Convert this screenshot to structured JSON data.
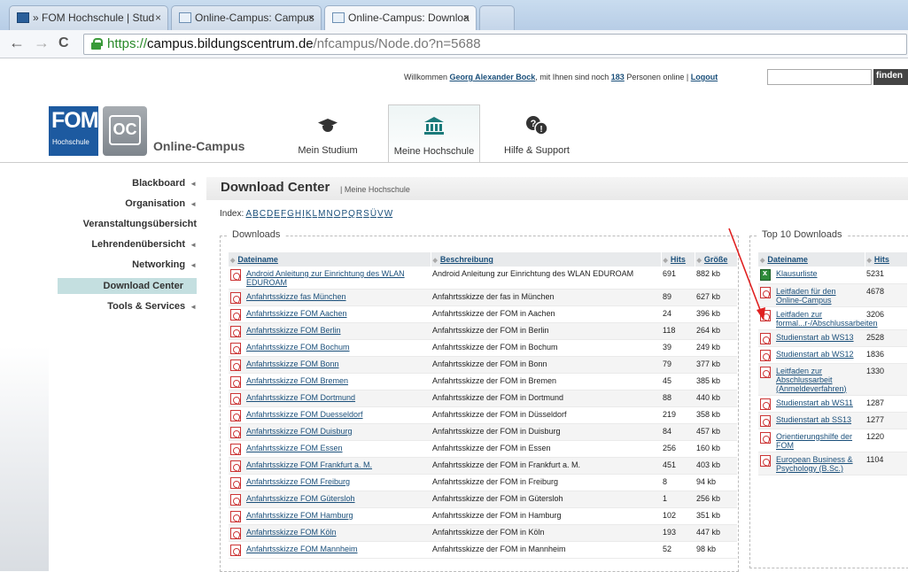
{
  "browser": {
    "tabs": [
      {
        "label": "» FOM Hochschule | Stud",
        "close": "×"
      },
      {
        "label": "Online-Campus: Campus",
        "close": "×"
      },
      {
        "label": "Online-Campus: Downloa",
        "close": "×"
      }
    ],
    "url": {
      "scheme": "https://",
      "host": "campus.bildungscentrum.de",
      "path": "/nfcampus/Node.do?n=5688"
    },
    "nav": {
      "back": "←",
      "forward": "→",
      "reload": "C"
    }
  },
  "header": {
    "welcome_prefix": "Willkommen ",
    "user_name": "Georg Alexander Bock",
    "welcome_middle": ", mit Ihnen sind noch ",
    "online_count": "183",
    "welcome_suffix": " Personen online | ",
    "logout": "Logout",
    "search_placeholder": "",
    "search_button": "finden",
    "logo_fom": "FOM",
    "logo_fom_sub": "Hochschule",
    "logo_oc": "OC",
    "logo_text": "Online-Campus",
    "nav": [
      {
        "label": "Mein Studium",
        "icon": "mortarboard-icon"
      },
      {
        "label": "Meine Hochschule",
        "icon": "building-columns-icon"
      },
      {
        "label": "Hilfe & Support",
        "icon": "help-bubbles-icon"
      }
    ]
  },
  "sidebar": {
    "items": [
      {
        "label": "Blackboard",
        "arrow": "◄"
      },
      {
        "label": "Organisation",
        "arrow": "◄"
      },
      {
        "label": "Veranstaltungsübersicht",
        "arrow": ""
      },
      {
        "label": "Lehrendenübersicht",
        "arrow": "◄"
      },
      {
        "label": "Networking",
        "arrow": "◄"
      },
      {
        "label": "Download Center",
        "arrow": ""
      },
      {
        "label": "Tools & Services",
        "arrow": "◄"
      }
    ],
    "active": "Download Center"
  },
  "main": {
    "title": "Download Center",
    "crumb": "| Meine Hochschule",
    "index_label": "Index: ",
    "index_letters": [
      "A",
      "B",
      "C",
      "D",
      "E",
      "F",
      "G",
      "H",
      "I",
      "K",
      "L",
      "M",
      "N",
      "O",
      "P",
      "Q",
      "R",
      "S",
      "Ü",
      "V",
      "W"
    ],
    "downloads": {
      "legend": "Downloads",
      "columns": [
        "Dateiname",
        "Beschreibung",
        "Hits",
        "Größe"
      ],
      "rows": [
        [
          "Android Anleitung zur Einrichtung des WLAN EDUROAM",
          "Android Anleitung zur Einrichtung des WLAN EDUROAM",
          "691",
          "882 kb"
        ],
        [
          "Anfahrtsskizze fas München",
          "Anfahrtsskizze der fas in München",
          "89",
          "627 kb"
        ],
        [
          "Anfahrtsskizze FOM Aachen",
          "Anfahrtsskizze der FOM in Aachen",
          "24",
          "396 kb"
        ],
        [
          "Anfahrtsskizze FOM Berlin",
          "Anfahrtsskizze der FOM in Berlin",
          "118",
          "264 kb"
        ],
        [
          "Anfahrtsskizze FOM Bochum",
          "Anfahrtsskizze der FOM in Bochum",
          "39",
          "249 kb"
        ],
        [
          "Anfahrtsskizze FOM Bonn",
          "Anfahrtsskizze der FOM in Bonn",
          "79",
          "377 kb"
        ],
        [
          "Anfahrtsskizze FOM Bremen",
          "Anfahrtsskizze der FOM in Bremen",
          "45",
          "385 kb"
        ],
        [
          "Anfahrtsskizze FOM Dortmund",
          "Anfahrtsskizze der FOM in Dortmund",
          "88",
          "440 kb"
        ],
        [
          "Anfahrtsskizze FOM Duesseldorf",
          "Anfahrtsskizze der FOM in Düsseldorf",
          "219",
          "358 kb"
        ],
        [
          "Anfahrtsskizze FOM Duisburg",
          "Anfahrtsskizze der FOM in Duisburg",
          "84",
          "457 kb"
        ],
        [
          "Anfahrtsskizze FOM Essen",
          "Anfahrtsskizze der FOM in Essen",
          "256",
          "160 kb"
        ],
        [
          "Anfahrtsskizze FOM Frankfurt a. M.",
          "Anfahrtsskizze der FOM in Frankfurt a. M.",
          "451",
          "403 kb"
        ],
        [
          "Anfahrtsskizze FOM Freiburg",
          "Anfahrtsskizze der FOM in Freiburg",
          "8",
          "94 kb"
        ],
        [
          "Anfahrtsskizze FOM Gütersloh",
          "Anfahrtsskizze der FOM in Gütersloh",
          "1",
          "256 kb"
        ],
        [
          "Anfahrtsskizze FOM Hamburg",
          "Anfahrtsskizze der FOM in Hamburg",
          "102",
          "351 kb"
        ],
        [
          "Anfahrtsskizze FOM Köln",
          "Anfahrtsskizze der FOM in Köln",
          "193",
          "447 kb"
        ],
        [
          "Anfahrtsskizze FOM Mannheim",
          "Anfahrtsskizze der FOM in Mannheim",
          "52",
          "98 kb"
        ]
      ]
    },
    "top10": {
      "legend": "Top 10 Downloads",
      "columns": [
        "Dateiname",
        "Hits"
      ],
      "rows": [
        {
          "name": "Klausurliste",
          "hits": "5231",
          "icon": "excel-icon"
        },
        {
          "name": "Leitfaden für den Online-Campus",
          "hits": "4678",
          "icon": "pdf-icon"
        },
        {
          "name": "Leitfaden zur formal...r-/Abschlussarbeiten",
          "hits": "3206",
          "icon": "pdf-icon"
        },
        {
          "name": "Studienstart ab WS13",
          "hits": "2528",
          "icon": "pdf-icon"
        },
        {
          "name": "Studienstart ab WS12",
          "hits": "1836",
          "icon": "pdf-icon"
        },
        {
          "name": "Leitfaden zur Abschlussarbeit (Anmeldeverfahren)",
          "hits": "1330",
          "icon": "pdf-icon"
        },
        {
          "name": "Studienstart ab WS11",
          "hits": "1287",
          "icon": "pdf-icon"
        },
        {
          "name": "Studienstart ab SS13",
          "hits": "1277",
          "icon": "pdf-icon"
        },
        {
          "name": "Orientierungshilfe der FOM",
          "hits": "1220",
          "icon": "pdf-icon"
        },
        {
          "name": "European Business & Psychology (B.Sc.)",
          "hits": "1104",
          "icon": "pdf-icon"
        }
      ]
    }
  },
  "colors": {
    "accent": "#1b7a7a",
    "link": "#1a4f7a",
    "sidebar_active": "#c4dfe0",
    "annotation_arrow": "#e02020"
  }
}
